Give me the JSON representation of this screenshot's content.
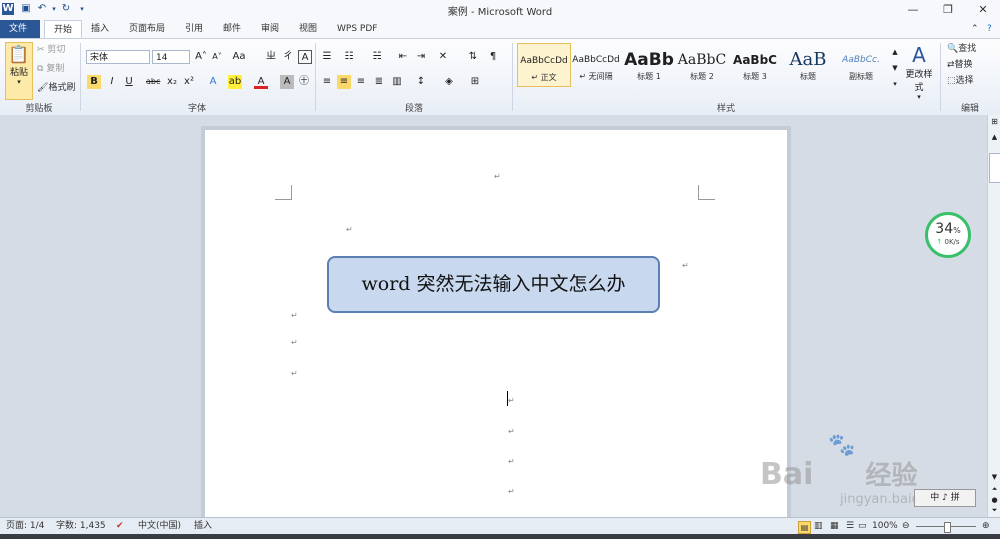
{
  "window": {
    "title": "案例 - Microsoft Word",
    "controls": [
      "minimize",
      "restore",
      "close"
    ]
  },
  "quick_access": [
    "word-logo",
    "save",
    "undo",
    "redo",
    "customize"
  ],
  "tabs": [
    {
      "label": "文件"
    },
    {
      "label": "开始"
    },
    {
      "label": "插入"
    },
    {
      "label": "页面布局"
    },
    {
      "label": "引用"
    },
    {
      "label": "邮件"
    },
    {
      "label": "审阅"
    },
    {
      "label": "视图"
    },
    {
      "label": "WPS PDF"
    }
  ],
  "ribbon": {
    "clipboard": {
      "paste": "粘贴",
      "cut": "剪切",
      "copy": "复制",
      "format_painter": "格式刷",
      "label": "剪贴板"
    },
    "font": {
      "font_name": "宋体",
      "font_size": "14",
      "label": "字体"
    },
    "paragraph": {
      "label": "段落"
    },
    "styles": {
      "items": [
        {
          "sample": "AaBbCcDd",
          "name": "↵ 正文"
        },
        {
          "sample": "AaBbCcDd",
          "name": "↵ 无间隔"
        },
        {
          "sample": "AaBb",
          "name": "标题 1"
        },
        {
          "sample": "AaBbC",
          "name": "标题 2"
        },
        {
          "sample": "AaBbC",
          "name": "标题 3"
        },
        {
          "sample": "AaB",
          "name": "标题"
        },
        {
          "sample": "AaBbCc.",
          "name": "副标题"
        }
      ],
      "change_styles": "更改样式",
      "label": "样式"
    },
    "editing": {
      "find": "查找",
      "replace": "替换",
      "select": "选择",
      "label": "编辑"
    }
  },
  "document": {
    "title_box": "word 突然无法输入中文怎么办"
  },
  "speed_widget": {
    "percent": "34",
    "percent_sign": "%",
    "rate": "0K/s"
  },
  "status_bar": {
    "page": "页面: 1/4",
    "words": "字数: 1,435",
    "language": "中文(中国)",
    "mode": "插入",
    "zoom": "100%"
  },
  "ime_indicator": "中 ♪ 拼",
  "watermark": {
    "brand": "Bai",
    "brand2": "经验",
    "url": "jingyan.baidu.com"
  }
}
